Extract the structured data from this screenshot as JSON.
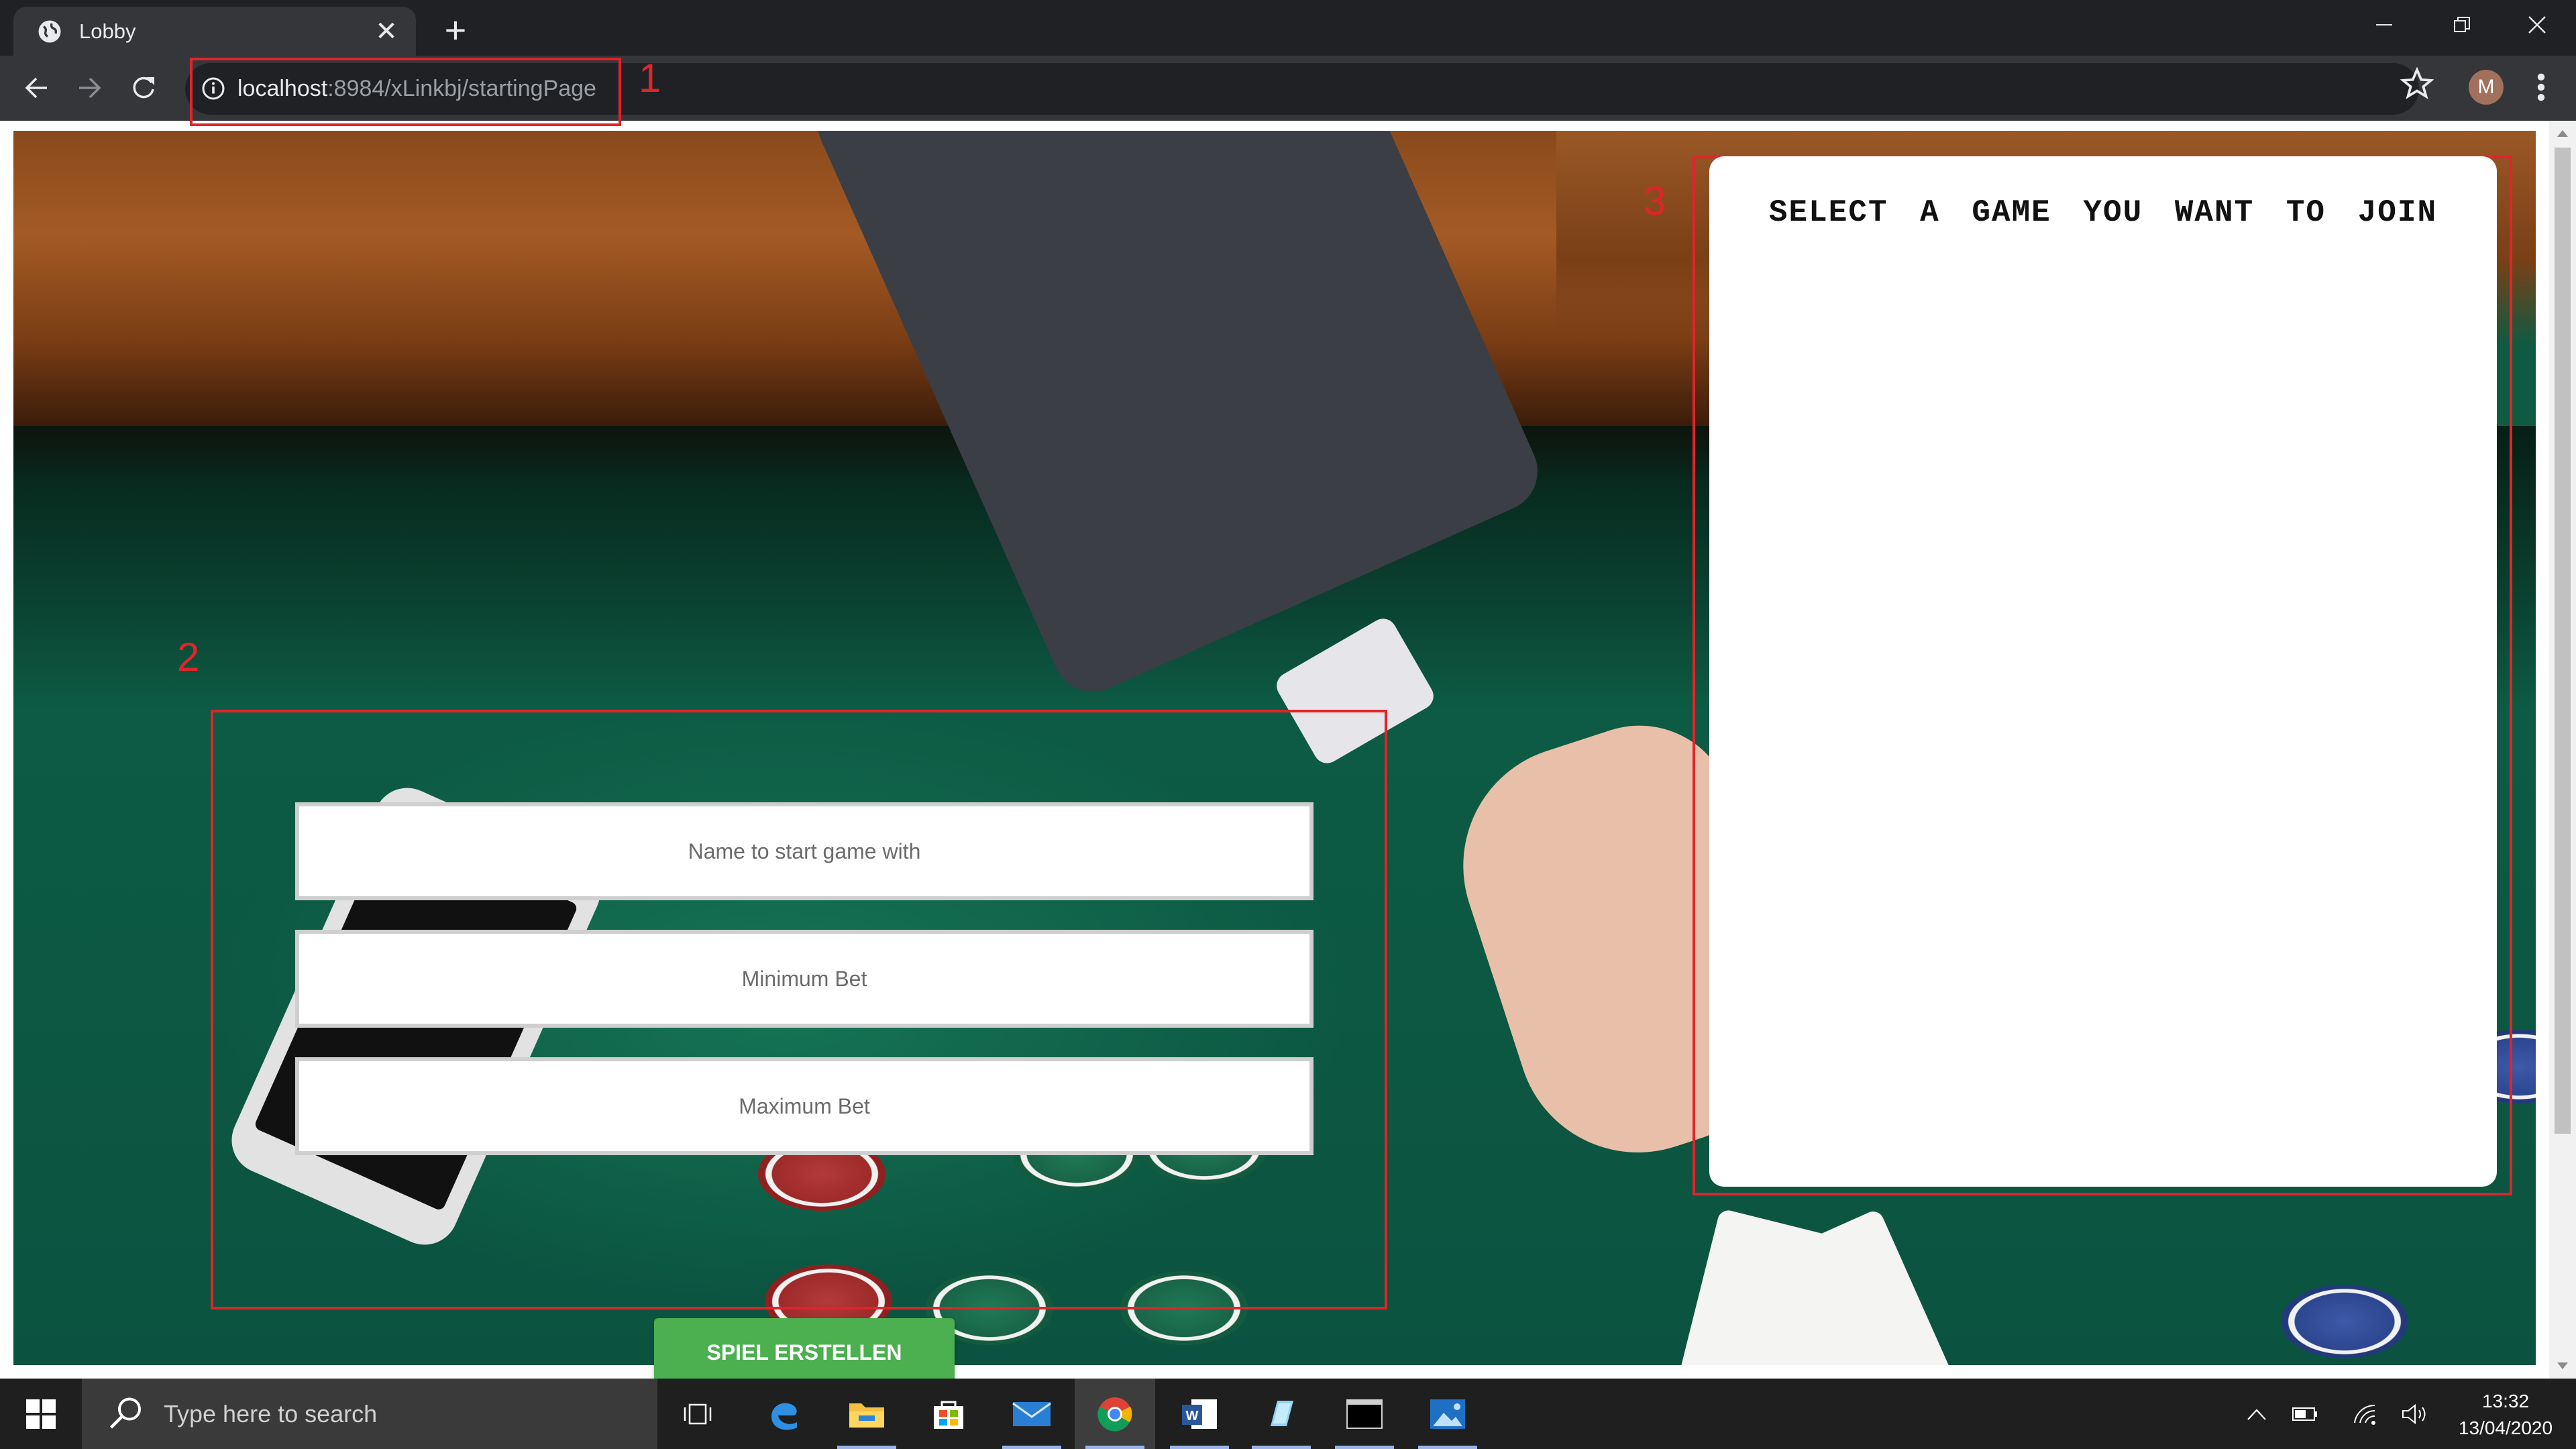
{
  "browser": {
    "tab": {
      "title": "Lobby",
      "close_glyph": "✕"
    },
    "new_tab_glyph": "+",
    "url_host": "localhost",
    "url_rest": ":8984/xLinkbj/startingPage",
    "profile_initial": "M"
  },
  "annotations": {
    "label_1": "1",
    "label_2": "2",
    "label_3": "3",
    "color": "#e0242b"
  },
  "form": {
    "name_placeholder": "Name to start game with",
    "min_bet_placeholder": "Minimum Bet",
    "max_bet_placeholder": "Maximum Bet",
    "create_button": "SPIEL ERSTELLEN",
    "button_color": "#4caf50"
  },
  "game_list": {
    "title": "SELECT A GAME YOU WANT TO JOIN"
  },
  "taskbar": {
    "search_placeholder": "Type here to search",
    "time": "13:32",
    "date": "13/04/2020",
    "apps": [
      "task-view-icon",
      "edge-icon",
      "file-explorer-icon",
      "store-icon",
      "mail-icon",
      "chrome-icon",
      "word-icon",
      "app-icon",
      "terminal-icon",
      "photos-icon"
    ]
  }
}
